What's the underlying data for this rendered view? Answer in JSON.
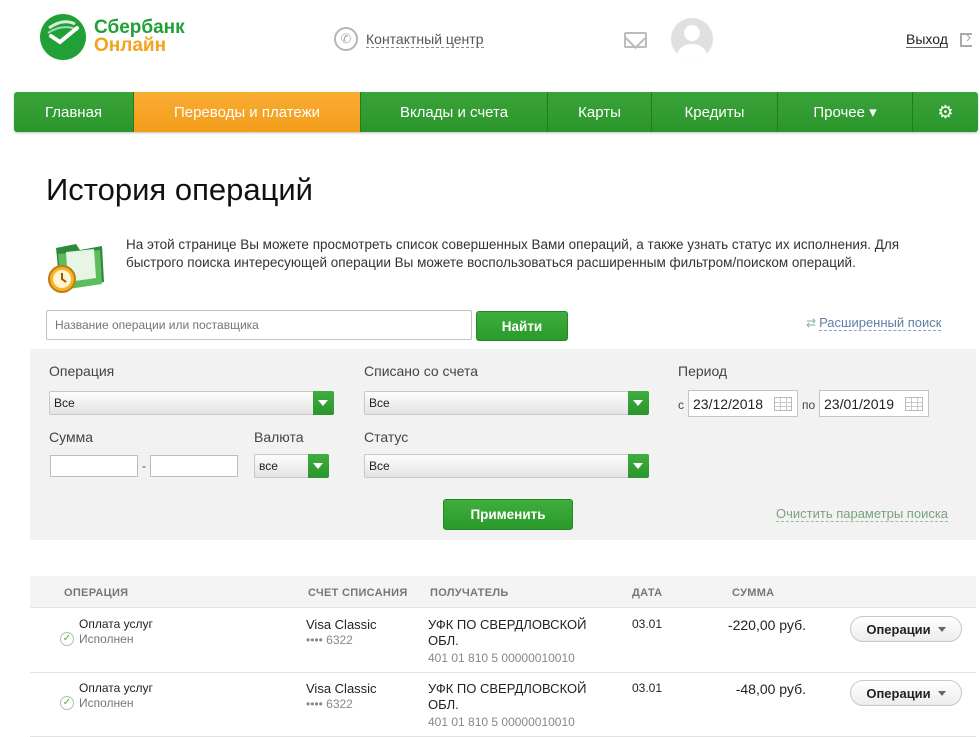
{
  "header": {
    "logo_line1": "Сбербанк",
    "logo_line2": "Онлайн",
    "contact_center": "Контактный центр",
    "logout": "Выход"
  },
  "nav": {
    "items": [
      {
        "label": "Главная"
      },
      {
        "label": "Переводы и платежи",
        "active": true
      },
      {
        "label": "Вклады и счета"
      },
      {
        "label": "Карты"
      },
      {
        "label": "Кредиты"
      },
      {
        "label": "Прочее ▾"
      }
    ],
    "settings_icon": "gear-icon"
  },
  "page": {
    "title": "История операций",
    "intro": "На этой странице Вы можете просмотреть список совершенных Вами операций, а также узнать статус их исполнения. Для быстрого поиска интересующей операции Вы можете воспользоваться расширенным фильтром/поиском операций."
  },
  "search": {
    "placeholder": "Название операции или поставщика",
    "button": "Найти",
    "extended": "Расширенный поиск"
  },
  "filters": {
    "operation_label": "Операция",
    "operation_value": "Все",
    "account_label": "Списано со счета",
    "account_value": "Все",
    "period_label": "Период",
    "from_prefix": "с",
    "date_from": "23/12/2018",
    "to_prefix": "по",
    "date_to": "23/01/2019",
    "sum_label": "Сумма",
    "sum_dash": "-",
    "currency_label": "Валюта",
    "currency_value": "все",
    "status_label": "Статус",
    "status_value": "Все",
    "apply": "Применить",
    "clear": "Очистить параметры поиска"
  },
  "table": {
    "headers": {
      "operation": "ОПЕРАЦИЯ",
      "account": "СЧЕТ СПИСАНИЯ",
      "recipient": "ПОЛУЧАТЕЛЬ",
      "date": "ДАТА",
      "amount": "СУММА"
    },
    "rows": [
      {
        "name": "Оплата услуг",
        "status": "Исполнен",
        "account": "Visa Classic",
        "account_num": "•••• 6322",
        "recipient": "УФК ПО СВЕРДЛОВСКОЙ ОБЛ.",
        "recipient_acc": "401 01 810 5 00000010010",
        "date": "03.01",
        "amount": "-220,00 руб.",
        "actions": "Операции"
      },
      {
        "name": "Оплата услуг",
        "status": "Исполнен",
        "account": "Visa Classic",
        "account_num": "•••• 6322",
        "recipient": "УФК ПО СВЕРДЛОВСКОЙ ОБЛ.",
        "recipient_acc": "401 01 810 5 00000010010",
        "date": "03.01",
        "amount": "-48,00 руб.",
        "actions": "Операции"
      }
    ]
  },
  "colors": {
    "brand_green": "#21a038",
    "brand_orange": "#f7a21b",
    "nav_green": "#2b962b",
    "nav_active": "#f39c1b"
  }
}
